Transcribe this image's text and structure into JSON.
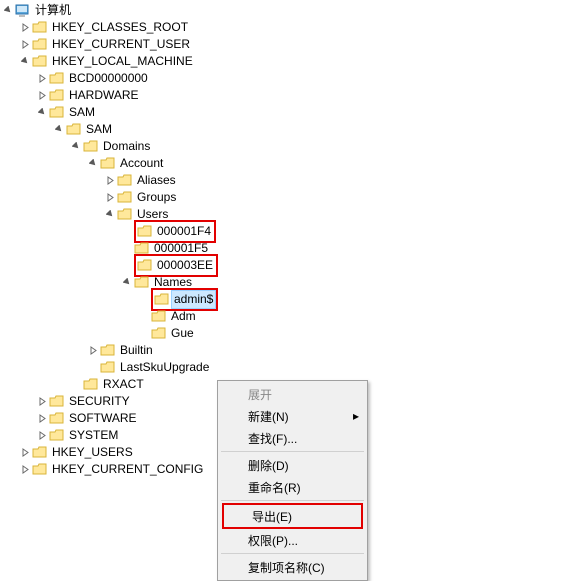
{
  "root": {
    "label": "计算机"
  },
  "hkcr": "HKEY_CLASSES_ROOT",
  "hkcu": "HKEY_CURRENT_USER",
  "hklm": "HKEY_LOCAL_MACHINE",
  "bcd": "BCD00000000",
  "hardware": "HARDWARE",
  "sam": "SAM",
  "sam2": "SAM",
  "domains": "Domains",
  "account": "Account",
  "aliases": "Aliases",
  "groups": "Groups",
  "users": "Users",
  "u1": "000001F4",
  "u2": "000001F5",
  "u3": "000003EE",
  "names": "Names",
  "admins": "admin$",
  "adm": "Adm",
  "gue": "Gue",
  "builtin": "Builtin",
  "lastsku": "LastSkuUpgrade",
  "rxact": "RXACT",
  "security": "SECURITY",
  "software": "SOFTWARE",
  "system": "SYSTEM",
  "hku": "HKEY_USERS",
  "hkcc": "HKEY_CURRENT_CONFIG",
  "menu": {
    "expand": "展开",
    "new": "新建(N)",
    "find": "查找(F)...",
    "delete": "删除(D)",
    "rename": "重命名(R)",
    "export": "导出(E)",
    "perm": "权限(P)...",
    "copyname": "复制项名称(C)"
  },
  "highlights": [
    "000001F4",
    "000003EE",
    "admin$",
    "导出(E)"
  ]
}
